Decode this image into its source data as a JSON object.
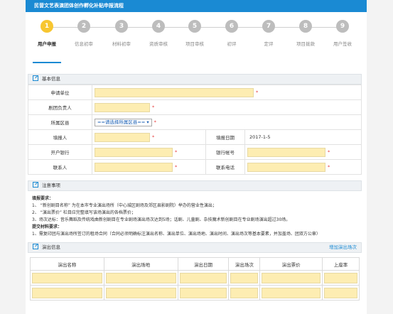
{
  "header": {
    "title": "民营文艺表演团体创作孵化补贴申报流程"
  },
  "steps": [
    {
      "num": "1",
      "label": "用户申报"
    },
    {
      "num": "2",
      "label": "信息初审"
    },
    {
      "num": "3",
      "label": "材料初审"
    },
    {
      "num": "4",
      "label": "资质审核"
    },
    {
      "num": "5",
      "label": "项目审核"
    },
    {
      "num": "6",
      "label": "初评"
    },
    {
      "num": "7",
      "label": "定评"
    },
    {
      "num": "8",
      "label": "项目拨款"
    },
    {
      "num": "9",
      "label": "用户签收"
    }
  ],
  "basic": {
    "title": "基本信息",
    "applicant_label": "申请单位",
    "leader_label": "剧团负责人",
    "district_label": "所属区县",
    "district_value": "==请选择所属区县==",
    "filler_label": "填报人",
    "fill_date_label": "填报日期",
    "fill_date_value": "2017-1-5",
    "bank_label": "开户银行",
    "account_label": "银行帐号",
    "contact_label": "联系人",
    "phone_label": "联系电话",
    "required_mark": "*"
  },
  "notes": {
    "title": "注意事项",
    "fill_req_title": "填报要求：",
    "items": [
      "1、 “新创剧目名称” 为在本市专业演出场所（中心城区剧场及郊区县影剧院）举办的营业性演出；",
      "2、 “演出票价” 栏目应完整填写该场演出的各档票价；",
      "3、场次达标：音乐舞蹈及传统戏曲新创剧目在专业剧场演出场次达到5场；话剧、儿童剧、杂技魔术新创剧目在专业剧场演出超过30场。"
    ],
    "submit_title": "提交材料要求：",
    "submit_items": [
      "1、需复印团与演出场所签订的租场合同（合同必须明确标注演出名称、演出单位、演出场地、演出时间、演出场次等基本要素，并加盖场、团双方公章）"
    ]
  },
  "performance": {
    "title": "演出信息",
    "add_link": "增加演出场次",
    "columns": [
      "演出名称",
      "演出场地",
      "演出日期",
      "演出场次",
      "演出票价",
      "上座率"
    ]
  },
  "colors": {
    "accent": "#1a8ad3",
    "active_step": "#f7c631",
    "field_bg": "#fdedb2",
    "required": "#e63a3a"
  }
}
